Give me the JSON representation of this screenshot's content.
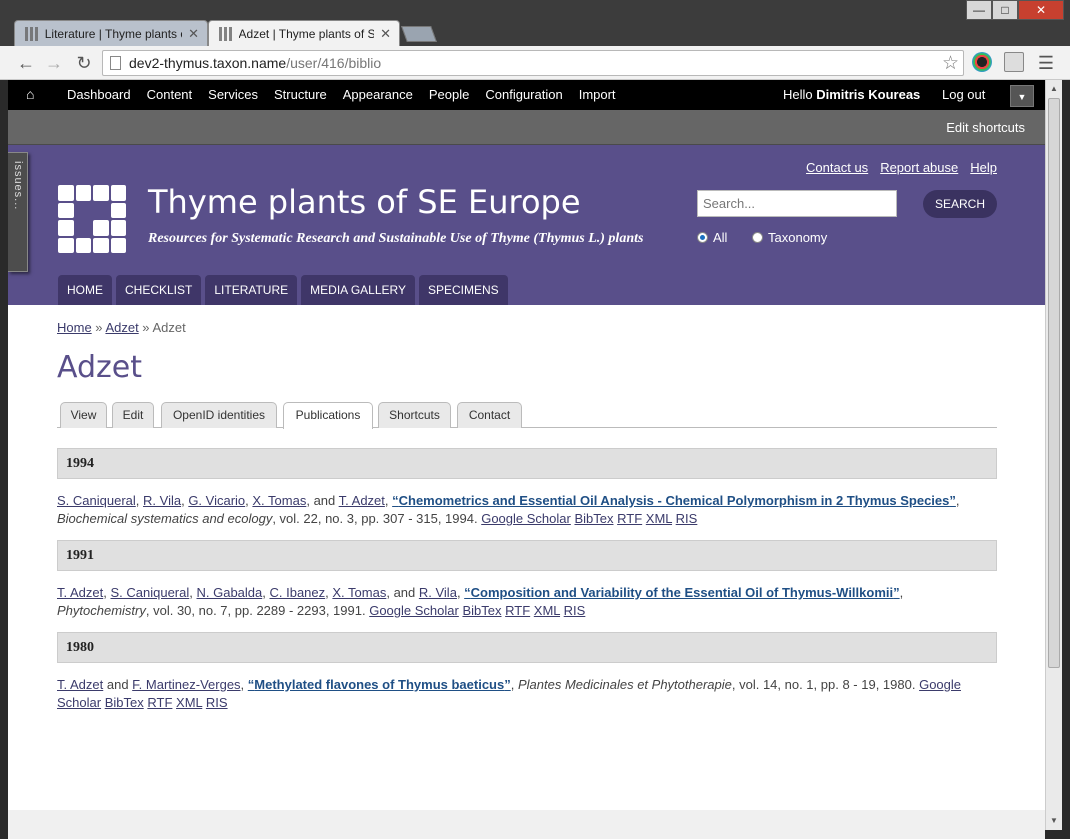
{
  "browser": {
    "tabs": [
      {
        "label": "Literature | Thyme plants o"
      },
      {
        "label": "Adzet | Thyme plants of SE"
      }
    ],
    "url_host": "dev2-thymus.taxon.name",
    "url_path": "/user/416/biblio"
  },
  "admin": {
    "menu": [
      "Dashboard",
      "Content",
      "Services",
      "Structure",
      "Appearance",
      "People",
      "Configuration",
      "Import"
    ],
    "hello": "Hello",
    "user": "Dimitris Koureas",
    "logout": "Log out",
    "edit_shortcuts": "Edit shortcuts"
  },
  "header": {
    "issues": "issues...",
    "site_name": "Thyme plants of SE Europe",
    "slogan": "Resources for Systematic Research and Sustainable Use of Thyme (Thymus L.) plants",
    "links": [
      "Contact us",
      "Report abuse",
      "Help"
    ],
    "search_placeholder": "Search...",
    "search_button": "SEARCH",
    "radio_all": "All",
    "radio_taxonomy": "Taxonomy",
    "nav": [
      "HOME",
      "CHECKLIST",
      "LITERATURE",
      "MEDIA GALLERY",
      "SPECIMENS"
    ]
  },
  "content": {
    "breadcrumb": [
      "Home",
      "Adzet",
      "Adzet"
    ],
    "title": "Adzet",
    "tabs": [
      "View",
      "Edit",
      "OpenID identities",
      "Publications",
      "Shortcuts",
      "Contact"
    ],
    "years": [
      "1994",
      "1991",
      "1980"
    ]
  },
  "links": [
    "Google Scholar",
    "BibTex",
    "RTF",
    "XML",
    "RIS"
  ],
  "pubs": [
    {
      "authors": [
        "S. Caniqueral",
        "R. Vila",
        "G. Vicario",
        "X. Tomas",
        "T. Adzet"
      ],
      "title": "Chemometrics and Essential Oil Analysis - Chemical Polymorphism in 2 Thymus Species",
      "journal": "Biochemical systematics and ecology",
      "rest": ", vol. 22, no. 3, pp. 307 - 315, 1994."
    },
    {
      "authors": [
        "T. Adzet",
        "S. Caniqueral",
        "N. Gabalda",
        "C. Ibanez",
        "X. Tomas",
        "R. Vila"
      ],
      "title": "Composition and Variability of the Essential Oil of Thymus-Willkomii",
      "journal": "Phytochemistry",
      "rest": ", vol. 30, no. 7, pp. 2289 - 2293, 1991."
    },
    {
      "authors": [
        "T. Adzet",
        "F. Martinez-Verges"
      ],
      "title": "Methylated flavones of Thymus baeticus",
      "journal": "Plantes Medicinales et Phytotherapie",
      "rest": ", vol. 14, no. 1, pp. 8 - 19, 1980."
    }
  ]
}
